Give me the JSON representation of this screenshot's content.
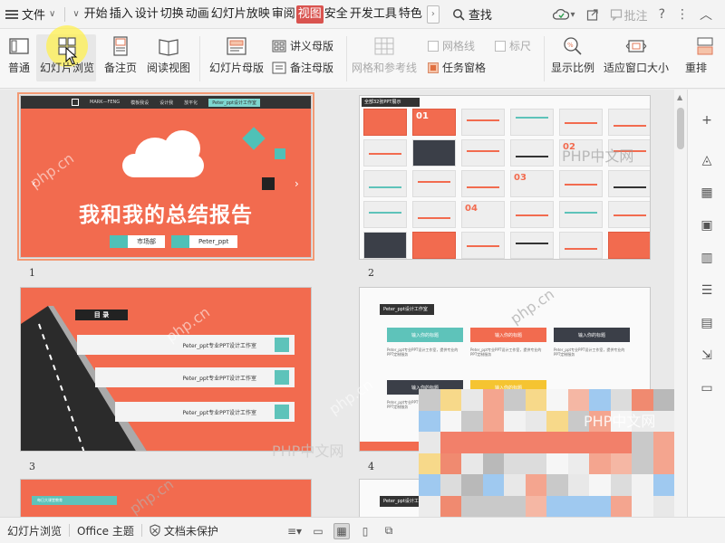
{
  "menubar": {
    "file_label": "文件",
    "tabs": [
      "开始",
      "插入",
      "设计",
      "切换",
      "动画",
      "幻灯片放映",
      "审阅",
      "视图",
      "安全",
      "开发工具",
      "特色"
    ],
    "active_tab": "视图",
    "search_label": "查找",
    "batch_label": "批注"
  },
  "ribbon": {
    "normal": "普通",
    "slide_browse": "幻灯片浏览",
    "notes_page": "备注页",
    "reading_view": "阅读视图",
    "slide_master": "幻灯片母版",
    "handout_master": "讲义母版",
    "notes_master": "备注母版",
    "grid_guides": "网格和参考线",
    "gridlines": "网格线",
    "ruler": "标尺",
    "task_pane": "任务窗格",
    "zoom": "显示比例",
    "fit_window": "适应窗口大小",
    "rearrange": "重排"
  },
  "slides": {
    "s1": {
      "number": "1",
      "title": "我和我的总结报告",
      "pill_left": "市场部",
      "pill_right": "Peter_ppt",
      "topbar_brand": "MARK—FENG",
      "topbar_items": [
        "模板我设",
        "设计我",
        "放平化",
        "Peter_ppt设计工作室"
      ]
    },
    "s2": {
      "number": "2",
      "label": "全部32张PPT展示",
      "nums": [
        "01",
        "02",
        "03",
        "04"
      ]
    },
    "s3": {
      "number": "3",
      "heading": "目 录",
      "items": [
        "Peter_ppt专业PPT设计工作室",
        "Peter_ppt专业PPT设计工作室",
        "Peter_ppt专业PPT设计工作室"
      ]
    },
    "s4": {
      "number": "4",
      "label": "Peter_ppt设计工作室",
      "cards": [
        "输入你的标题",
        "输入你的标题",
        "输入你的标题",
        "输入你的标题",
        "输入你的标题"
      ],
      "body": "Peter_ppt专业PPT设计工作室，提供专业的PPT定制服务"
    },
    "s5": {
      "band": "每日大课堂教育"
    },
    "s6": {
      "label": "Peter_ppt设计工作室"
    }
  },
  "watermarks": {
    "php_cn": "php.cn",
    "php_zh": "PHP中文网"
  },
  "statusbar": {
    "slide_browse": "幻灯片浏览",
    "office_theme": "Office 主题",
    "doc_unprotected": "文档未保护"
  },
  "colors": {
    "accent": "#d9534f",
    "slide_orange": "#f26b4f",
    "teal": "#4fc1b7",
    "selected_border": "#f29a75"
  }
}
